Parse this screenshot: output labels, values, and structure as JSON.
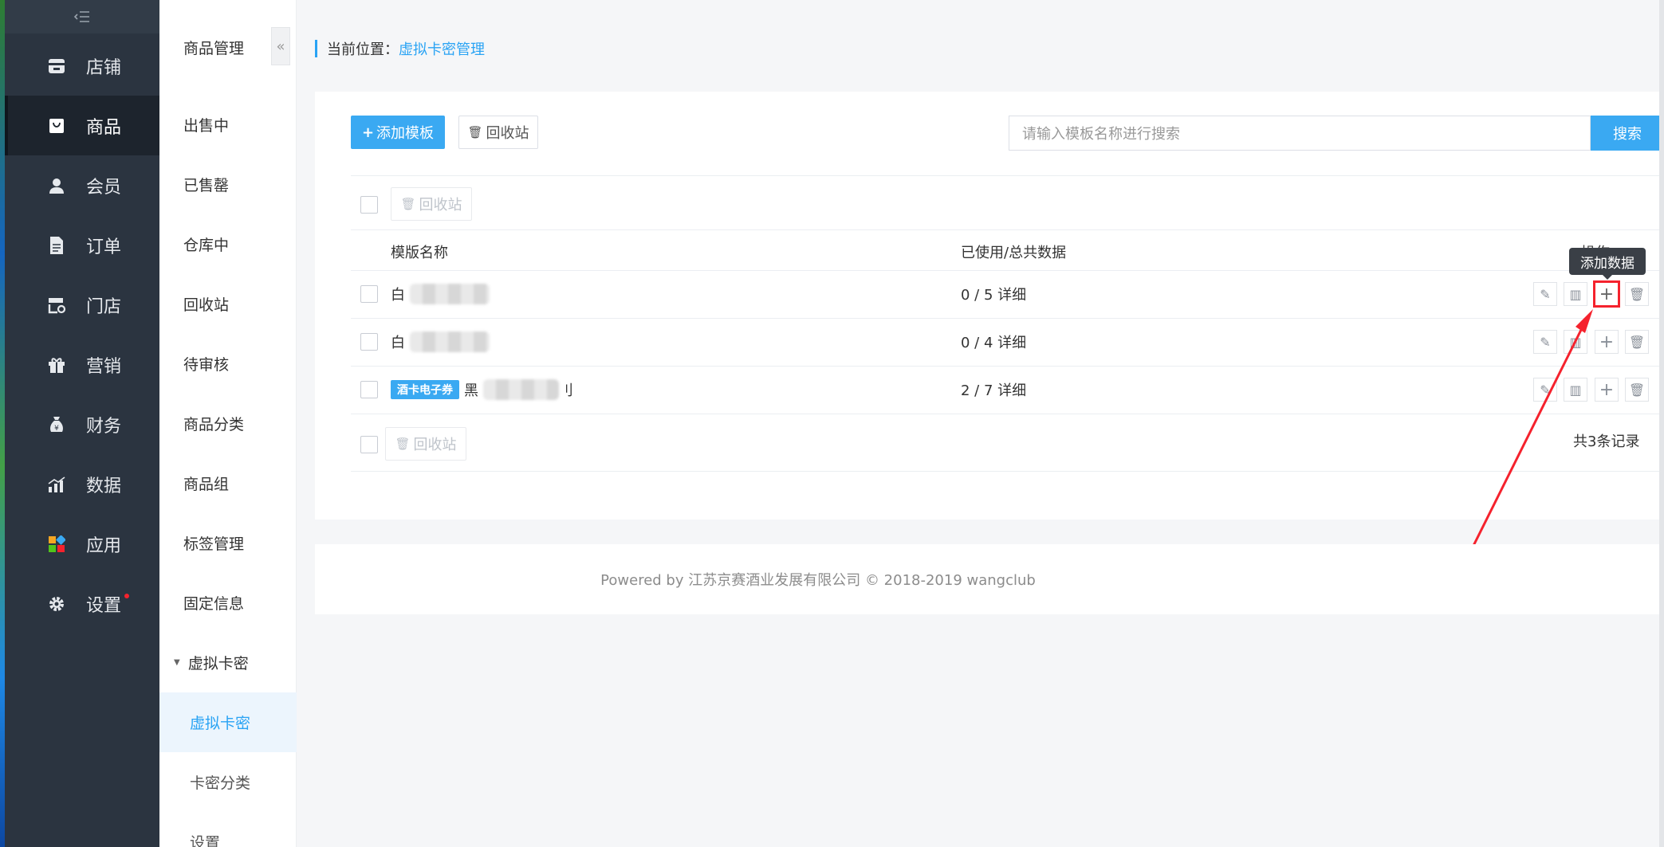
{
  "sidebar": {
    "collapse_icon": "collapse-menu-icon",
    "items": [
      {
        "label": "店铺",
        "icon": "store-icon"
      },
      {
        "label": "商品",
        "icon": "bag-icon",
        "active": true
      },
      {
        "label": "会员",
        "icon": "user-icon"
      },
      {
        "label": "订单",
        "icon": "document-icon"
      },
      {
        "label": "门店",
        "icon": "shop-settings-icon"
      },
      {
        "label": "营销",
        "icon": "gift-icon"
      },
      {
        "label": "财务",
        "icon": "money-bag-icon"
      },
      {
        "label": "数据",
        "icon": "chart-icon"
      },
      {
        "label": "应用",
        "icon": "apps-icon"
      },
      {
        "label": "设置",
        "icon": "gear-icon",
        "badge": true
      }
    ]
  },
  "submenu": {
    "title": "商品管理",
    "items": [
      "出售中",
      "已售罄",
      "仓库中",
      "回收站",
      "待审核",
      "商品分类",
      "商品组",
      "标签管理",
      "固定信息"
    ],
    "group": {
      "label": "虚拟卡密",
      "children": [
        "虚拟卡密",
        "卡密分类",
        "设置"
      ]
    }
  },
  "breadcrumb": {
    "prefix": "当前位置：",
    "current": "虚拟卡密管理"
  },
  "toolbar": {
    "add_label": "添加模板",
    "recycle_label": "回收站",
    "search_placeholder": "请输入模板名称进行搜索",
    "search_label": "搜索"
  },
  "table": {
    "batch_recycle_label": "回收站",
    "headers": {
      "name": "模版名称",
      "usage": "已使用/总共数据",
      "ops": "操作"
    },
    "rows": [
      {
        "tag": "",
        "name_visible": "白",
        "usage": "0 / 5 详细"
      },
      {
        "tag": "",
        "name_visible": "白",
        "usage": "0 / 4 详细"
      },
      {
        "tag": "酒卡电子券",
        "name_visible": "黑",
        "name_suffix": "刂",
        "usage": "2 / 7 详细"
      }
    ],
    "total": "共3条记录",
    "tooltip": "添加数据"
  },
  "footer": {
    "text": "Powered by 江苏京赛酒业发展有限公司 © 2018-2019 wangclub"
  },
  "colors": {
    "accent": "#3aa9f2",
    "sidebar_bg": "#2b3440",
    "highlight_red": "#f5222d"
  }
}
